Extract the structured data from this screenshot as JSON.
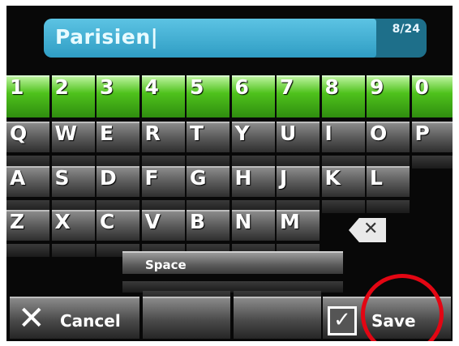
{
  "input": {
    "value": "Parisien|",
    "counter": "8/24"
  },
  "keyboard": {
    "numbers": [
      "1",
      "2",
      "3",
      "4",
      "5",
      "6",
      "7",
      "8",
      "9",
      "0"
    ],
    "row1": [
      "Q",
      "W",
      "E",
      "R",
      "T",
      "Y",
      "U",
      "I",
      "O",
      "P"
    ],
    "row2": [
      "A",
      "S",
      "D",
      "F",
      "G",
      "H",
      "J",
      "K",
      "L"
    ],
    "row3": [
      "Z",
      "X",
      "C",
      "V",
      "B",
      "N",
      "M"
    ],
    "backspace_icon": "backspace-icon",
    "space_label": "Space"
  },
  "actions": {
    "cancel_label": "Cancel",
    "cancel_icon": "close-icon",
    "save_label": "Save",
    "save_icon": "checkbox-icon",
    "highlight_color": "#e30613"
  }
}
